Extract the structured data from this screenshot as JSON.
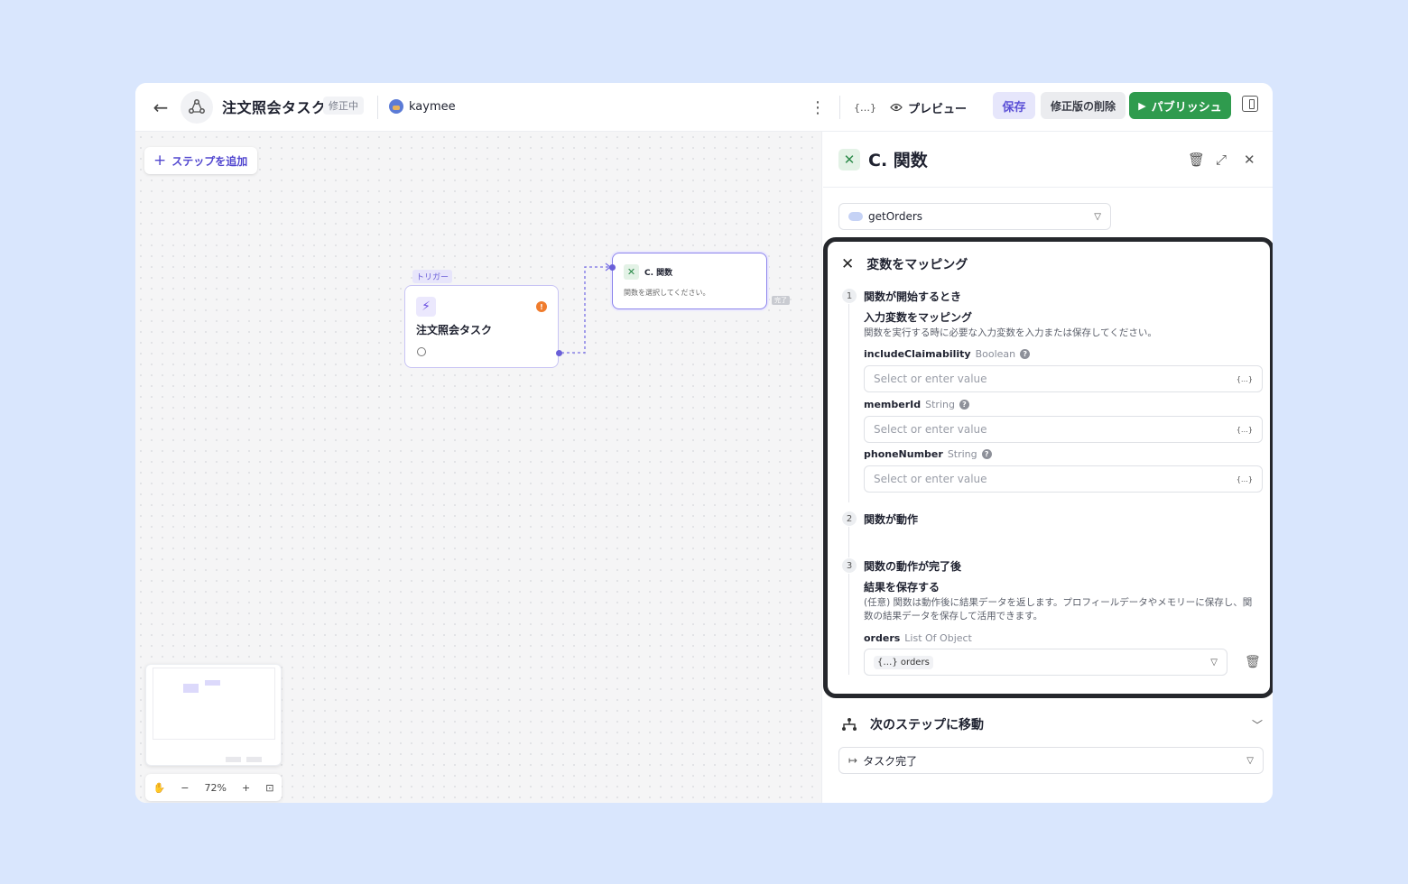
{
  "header": {
    "title": "注文照会タスク",
    "status_badge": "修正中",
    "user": "kaymee",
    "var_icon": "{…}",
    "preview_label": "プレビュー",
    "save_label": "保存",
    "delete_label": "修正版の削除",
    "publish_label": "パブリッシュ"
  },
  "canvas": {
    "add_step_label": "ステップを追加",
    "trigger_tag": "トリガー",
    "trigger_node_label": "注文照会タスク",
    "function_node_title": "C. 関数",
    "function_node_subtitle": "関数を選択してください。",
    "done_tag": "完了",
    "zoom_level": "72%"
  },
  "panel": {
    "title": "C. 関数",
    "selected_function": "getOrders",
    "mapping_section": "変数をマッピング",
    "steps": [
      {
        "number": "1",
        "title": "関数が開始するとき",
        "subtitle": "入力変数をマッピング",
        "description": "関数を実行する時に必要な入力変数を入力または保存してください。"
      },
      {
        "number": "2",
        "title": "関数が動作"
      },
      {
        "number": "3",
        "title": "関数の動作が完了後",
        "subtitle": "結果を保存する",
        "description": "(任意) 関数は動作後に結果データを返します。プロフィールデータやメモリーに保存し、関数の結果データを保存して活用できます。"
      }
    ],
    "fields": [
      {
        "name": "includeClaimability",
        "type": "Boolean",
        "placeholder": "Select or enter value"
      },
      {
        "name": "memberId",
        "type": "String",
        "placeholder": "Select or enter value"
      },
      {
        "name": "phoneNumber",
        "type": "String",
        "placeholder": "Select or enter value"
      }
    ],
    "output": {
      "name": "orders",
      "type": "List Of Object",
      "value": "orders"
    },
    "next_step_section": "次のステップに移動",
    "next_step_value": "タスク完了"
  },
  "colors": {
    "accent": "#5b50d6",
    "publish": "#2f9b4e",
    "highlight_border": "#25272c"
  }
}
